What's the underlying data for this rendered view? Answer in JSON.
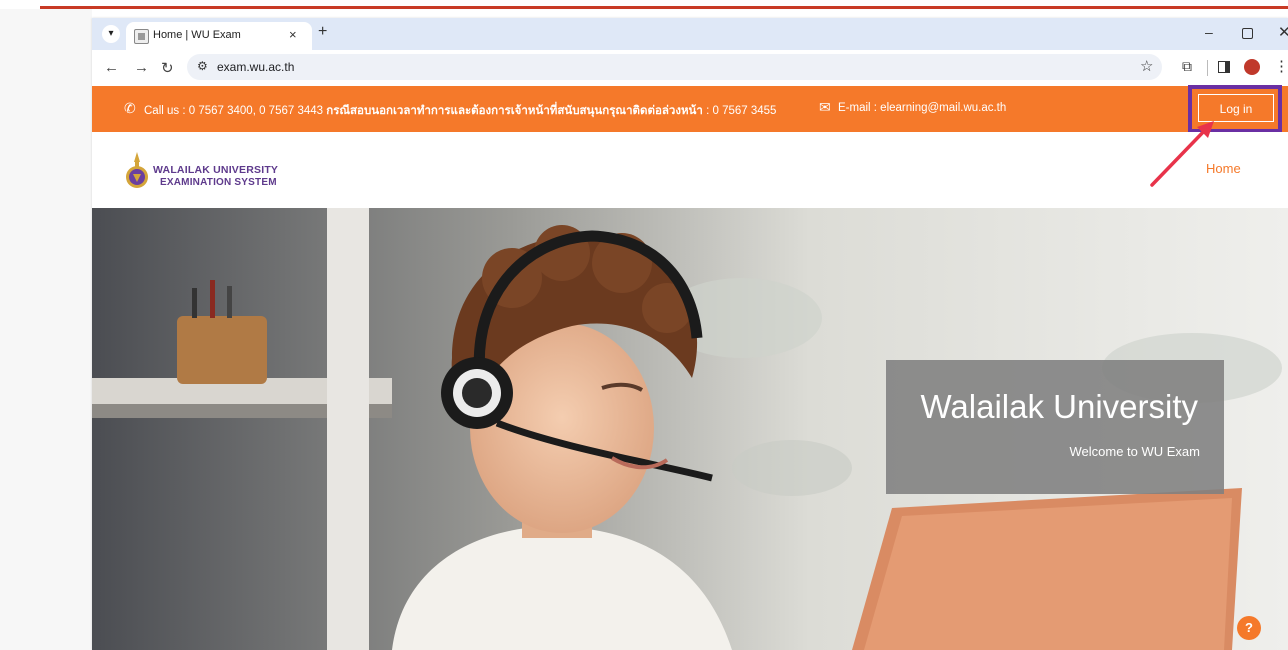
{
  "browser": {
    "tab_title": "Home | WU Exam",
    "tab_close": "×",
    "new_tab": "+",
    "url": "exam.wu.ac.th"
  },
  "topbar": {
    "contact_prefix": "Call us : 0 7567 3400, 0 7567 3443 ",
    "contact_bold": "กรณีสอบนอกเวลาทำการและต้องการเจ้าหน้าที่สนับสนุนกรุณาติดต่อล่วงหน้า",
    "contact_suffix": " : 0 7567 3455",
    "email": "E-mail : elearning@mail.wu.ac.th",
    "login_label": "Log in",
    "bg_color": "#f5792a"
  },
  "header": {
    "logo_line1": "WALAILAK UNIVERSITY",
    "logo_line2": "EXAMINATION SYSTEM",
    "nav_home": "Home"
  },
  "hero": {
    "title": "Walailak University",
    "subtitle": "Welcome to WU Exam"
  },
  "help": {
    "label": "?"
  },
  "annotation": {
    "highlight_color": "#6a2fa3",
    "arrow_color": "#e8334a"
  }
}
